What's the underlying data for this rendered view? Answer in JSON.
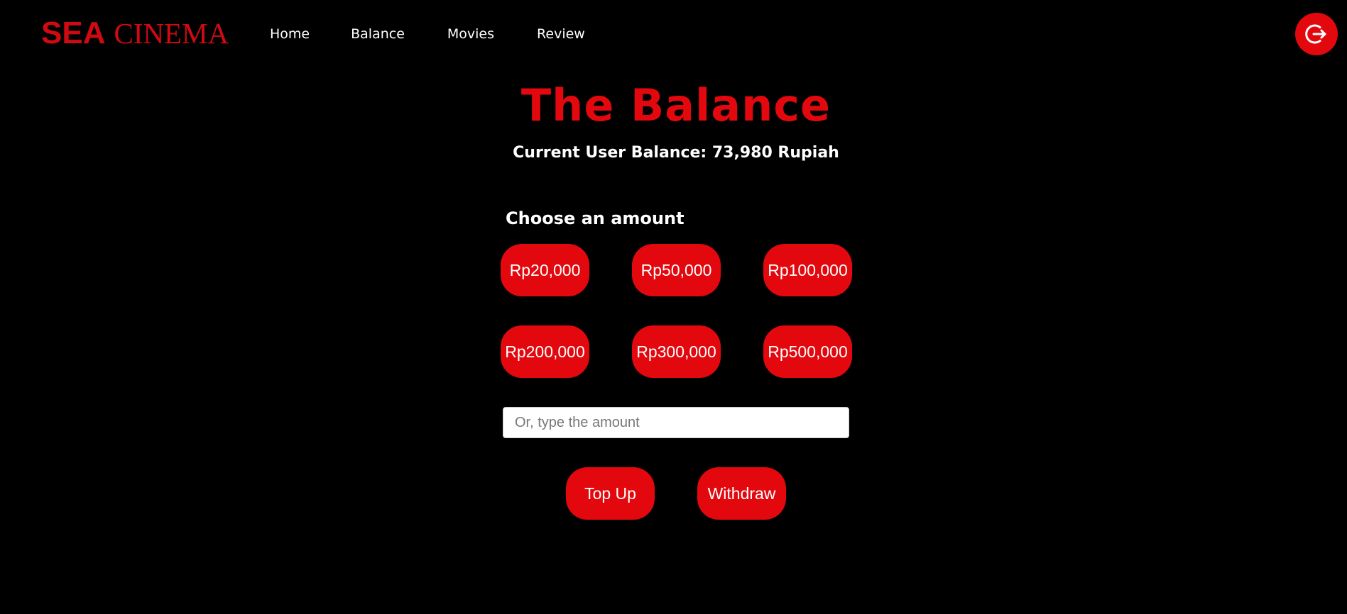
{
  "navbar": {
    "logo_primary": "SEA",
    "logo_secondary": "CINEMA",
    "links": [
      {
        "label": "Home"
      },
      {
        "label": "Balance"
      },
      {
        "label": "Movies"
      },
      {
        "label": "Review"
      }
    ],
    "logout_icon": "logout-icon"
  },
  "main": {
    "title": "The Balance",
    "balance_text": "Current User Balance: 73,980 Rupiah",
    "choose_label": "Choose an amount",
    "amounts": [
      "Rp20,000",
      "Rp50,000",
      "Rp100,000",
      "Rp200,000",
      "Rp300,000",
      "Rp500,000"
    ],
    "input_placeholder": "Or, type the amount",
    "input_value": "",
    "top_up_label": "Top Up",
    "withdraw_label": "Withdraw"
  },
  "colors": {
    "accent": "#e3080e",
    "logo": "#d10a12",
    "background": "#000000"
  }
}
